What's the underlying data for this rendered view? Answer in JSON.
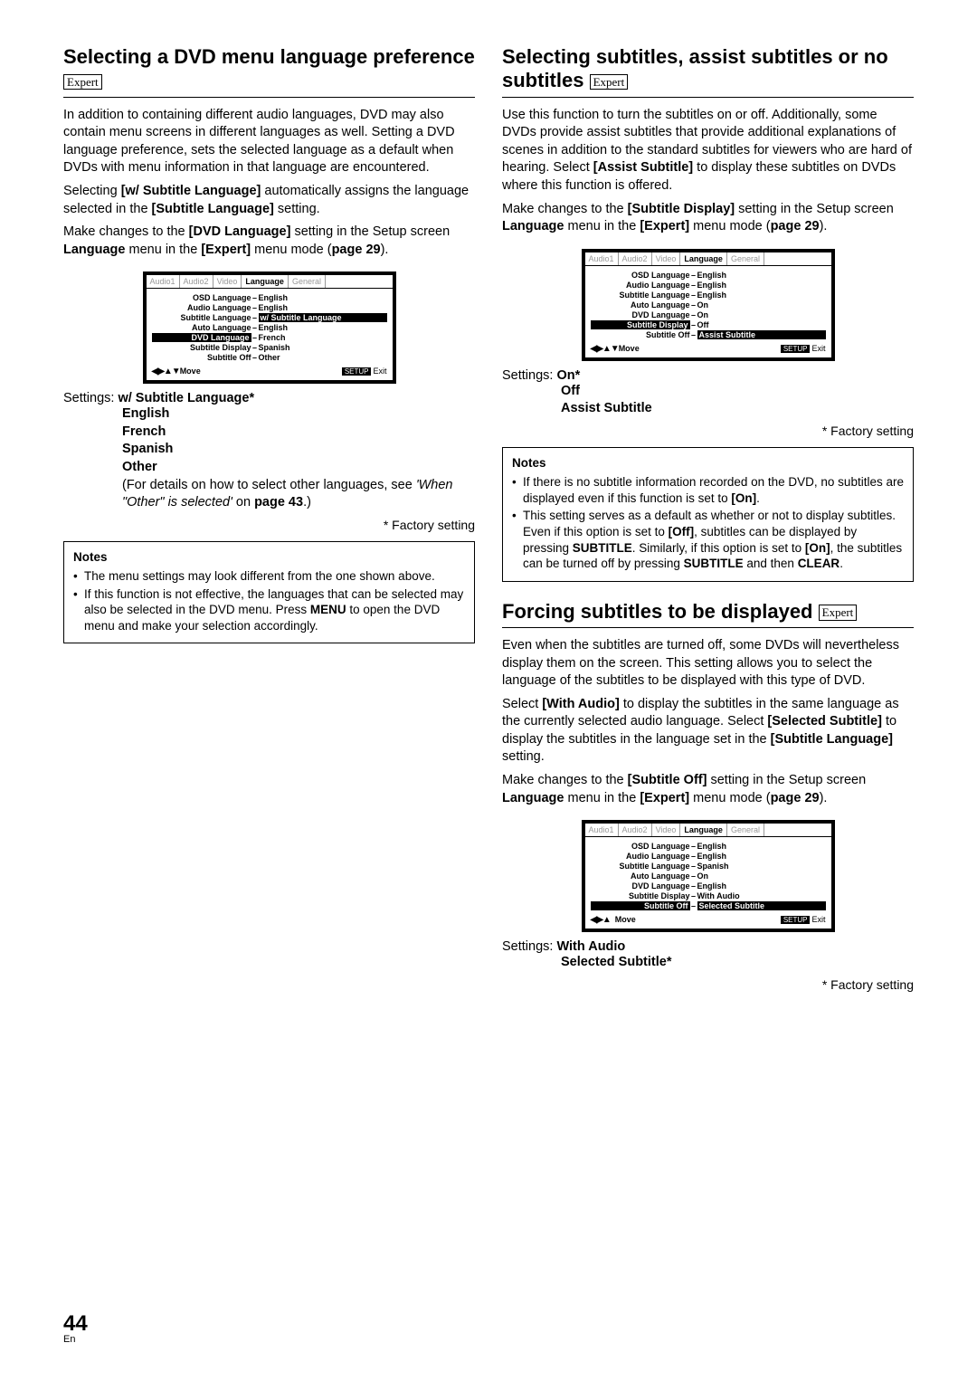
{
  "page": {
    "number": "44",
    "lang": "En"
  },
  "expert_label": "Expert",
  "factory_note": "* Factory setting",
  "osd": {
    "tabs": [
      "Audio1",
      "Audio2",
      "Video",
      "Language",
      "General"
    ],
    "footer_move": "Move",
    "footer_setup": "SETUP",
    "footer_exit": "Exit"
  },
  "left": {
    "h1": "Selecting a DVD menu language preference",
    "p1a": "In addition to containing different audio languages, DVD may also contain menu screens in different languages as well. Setting a DVD language preference, sets the selected language as a default when DVDs with menu information in that language are encountered.",
    "p1b_pre": "Selecting ",
    "p1b_bold": "[w/ Subtitle Language]",
    "p1b_post": " automatically assigns the language selected in the ",
    "p1b_bold2": "[Subtitle Language]",
    "p1b_end": " setting.",
    "p2_pre": "Make changes to the ",
    "p2_b1": "[DVD Language]",
    "p2_mid": " setting in the Setup screen ",
    "p2_b2": "Language",
    "p2_mid2": " menu in the ",
    "p2_b3": "[Expert]",
    "p2_end": " menu mode (",
    "p2_b4": "page 29",
    "p2_close": ").",
    "osd_rows": [
      {
        "label": "OSD Language",
        "val": "English"
      },
      {
        "label": "Audio Language",
        "val": "English"
      },
      {
        "label": "Subtitle Language",
        "val": "w/ Subtitle Language",
        "hl": "hl-val"
      },
      {
        "label": "Auto Language",
        "val": "English"
      },
      {
        "label": "DVD Language",
        "val": "French",
        "hl": "hl"
      },
      {
        "label": "Subtitle Display",
        "val": "Spanish"
      },
      {
        "label": "Subtitle Off",
        "val": "Other"
      }
    ],
    "settings_label": "Settings:",
    "settings_first": "w/ Subtitle Language*",
    "settings_values": [
      "English",
      "French",
      "Spanish",
      "Other"
    ],
    "settings_paren_a": "(For details on how to select other languages, see ",
    "settings_paren_i": "'When \"Other\" is selected'",
    "settings_paren_b": " on ",
    "settings_paren_pg": "page 43",
    "settings_paren_c": ".)",
    "notes_title": "Notes",
    "notes": [
      "The menu settings may look different from the one shown above.",
      "If this function is not effective, the languages that can be selected may also be selected in the DVD menu. Press <b>MENU</b> to open the DVD menu and make your selection accordingly."
    ]
  },
  "right": {
    "h1": "Selecting subtitles, assist subtitles or no subtitles",
    "p1_a": "Use this function to turn the subtitles on or off. Additionally, some DVDs provide assist subtitles that provide additional explanations of scenes in addition to the standard subtitles for viewers who are hard of hearing. Select ",
    "p1_b1": "[Assist Subtitle]",
    "p1_b": " to display these subtitles on DVDs where this function is offered.",
    "p2_pre": "Make changes to the ",
    "p2_b1": "[Subtitle Display]",
    "p2_mid": " setting in the Setup screen ",
    "p2_b2": "Language",
    "p2_mid2": " menu in the ",
    "p2_b3": "[Expert]",
    "p2_end": " menu mode (",
    "p2_b4": "page 29",
    "p2_close": ").",
    "osd_rows": [
      {
        "label": "OSD Language",
        "val": "English"
      },
      {
        "label": "Audio Language",
        "val": "English"
      },
      {
        "label": "Subtitle Language",
        "val": "English"
      },
      {
        "label": "Auto Language",
        "val": "On"
      },
      {
        "label": "DVD Language",
        "val": "On"
      },
      {
        "label": "Subtitle Display",
        "val": "Off",
        "hl": "hl"
      },
      {
        "label": "Subtitle Off",
        "val": "Assist Subtitle",
        "hl": "hl-val"
      }
    ],
    "settings_label": "Settings:",
    "settings_values": [
      "On*",
      "Off",
      "Assist Subtitle"
    ],
    "notes_title": "Notes",
    "note1": "If there is no subtitle information recorded on the DVD, no subtitles are displayed even if this function is set to <b>[On]</b>.",
    "note2": "This setting serves as a default as whether or not to display subtitles. Even if this option is set to <b>[Off]</b>, subtitles can be displayed by pressing <b>SUBTITLE</b>. Similarly, if this option is set to <b>[On]</b>, the subtitles can be turned off by pressing <b>SUBTITLE</b> and then <b>CLEAR</b>.",
    "h2": "Forcing subtitles to be displayed",
    "h2_p1": "Even when the subtitles are turned off, some DVDs will nevertheless display them on the screen. This setting allows you to select the language of the subtitles to be displayed with this type of DVD.",
    "h2_p2_a": "Select ",
    "h2_p2_b1": "[With Audio]",
    "h2_p2_b": " to display the subtitles in the same language as the currently selected audio language. Select ",
    "h2_p2_b2": "[Selected Subtitle]",
    "h2_p2_c": " to display the subtitles in the language set in the ",
    "h2_p2_b3": "[Subtitle Language]",
    "h2_p2_d": " setting.",
    "h2_p3_pre": "Make changes to the ",
    "h2_p3_b1": "[Subtitle Off]",
    "h2_p3_mid": " setting in the Setup screen ",
    "h2_p3_b2": "Language",
    "h2_p3_mid2": " menu in the ",
    "h2_p3_b3": "[Expert]",
    "h2_p3_end": " menu mode (",
    "h2_p3_b4": "page 29",
    "h2_p3_close": ").",
    "osd2_rows": [
      {
        "label": "OSD Language",
        "val": "English"
      },
      {
        "label": "Audio Language",
        "val": "English"
      },
      {
        "label": "Subtitle Language",
        "val": "Spanish"
      },
      {
        "label": "Auto Language",
        "val": "On"
      },
      {
        "label": "DVD Language",
        "val": "English"
      },
      {
        "label": "Subtitle Display",
        "val": "With Audio"
      },
      {
        "label": "Subtitle Off",
        "val": "Selected Subtitle",
        "hl": "hl-both"
      }
    ],
    "h2_settings_label": "Settings:",
    "h2_settings_values": [
      "With Audio",
      "Selected Subtitle*"
    ]
  }
}
